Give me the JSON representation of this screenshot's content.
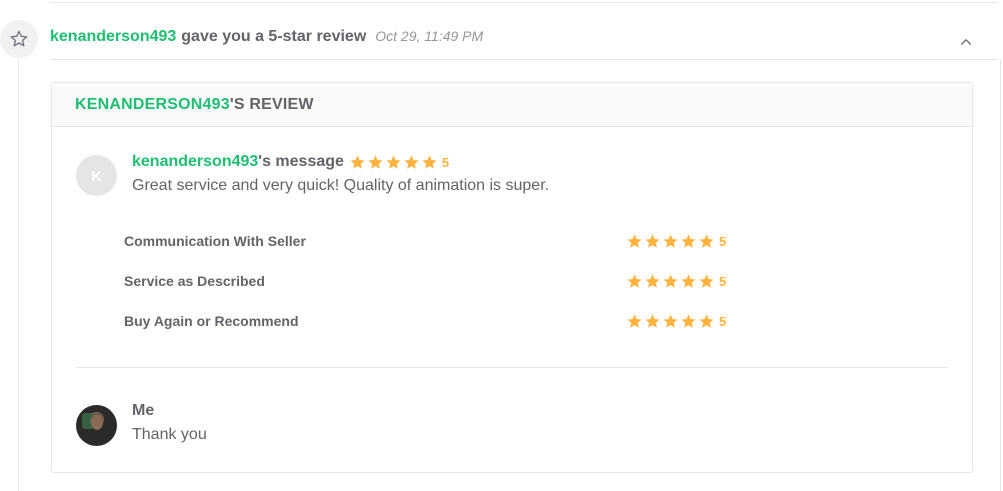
{
  "event": {
    "username": "kenanderson493",
    "action_text": "gave you a 5-star review",
    "timestamp": "Oct 29, 11:49 PM",
    "icon": "star-outline-icon",
    "collapse_icon": "chevron-up-icon"
  },
  "review": {
    "header_user": "KENANDERSON493",
    "header_suffix": "'S REVIEW",
    "avatar_letter": "K",
    "message_user": "kenanderson493",
    "message_suffix": "'s message",
    "overall_rating": "5",
    "message_text": "Great service and very quick! Quality of animation is super.",
    "ratings": [
      {
        "label": "Communication With Seller",
        "value": "5"
      },
      {
        "label": "Service as Described",
        "value": "5"
      },
      {
        "label": "Buy Again or Recommend",
        "value": "5"
      }
    ]
  },
  "reply": {
    "name": "Me",
    "text": "Thank you"
  },
  "colors": {
    "brand_green": "#1dbf73",
    "star_orange": "#ffb33e",
    "text_gray": "#62646a"
  }
}
